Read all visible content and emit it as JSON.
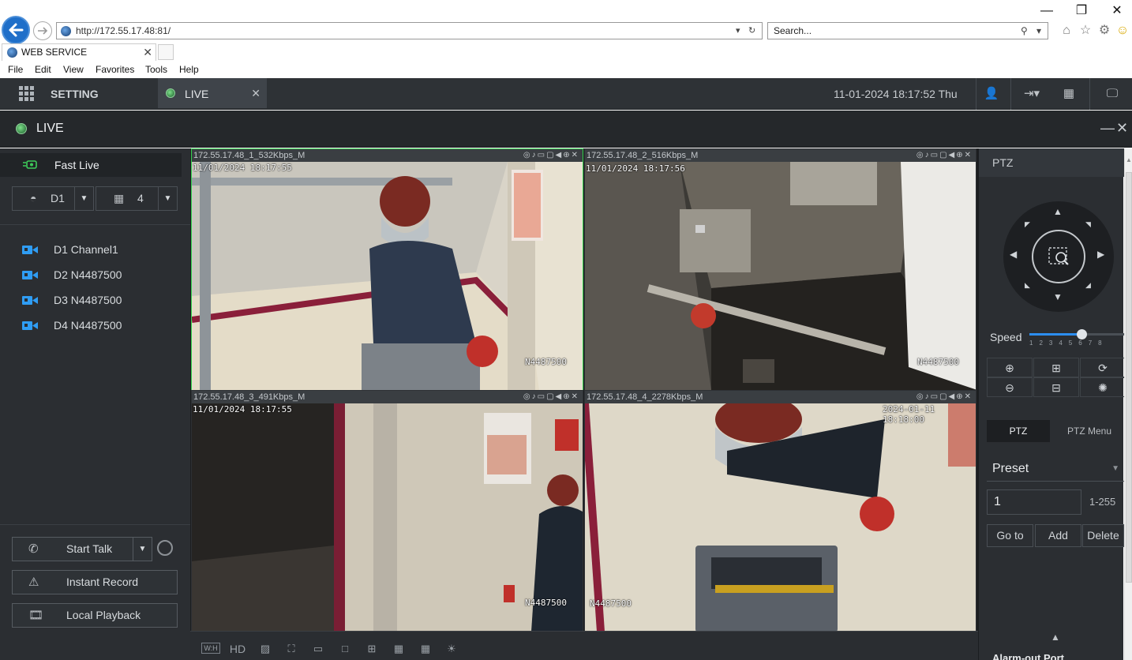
{
  "browser": {
    "address": "http://172.55.17.48:81/",
    "search_placeholder": "Search...",
    "tab_title": "WEB SERVICE",
    "menu": [
      "File",
      "Edit",
      "View",
      "Favorites",
      "Tools",
      "Help"
    ]
  },
  "app": {
    "setting_label": "SETTING",
    "live_tab_label": "LIVE",
    "datetime": "11-01-2024 18:17:52 Thu",
    "live_header": "LIVE"
  },
  "left": {
    "fast_live": "Fast Live",
    "device_select": "D1",
    "split_select": "4",
    "channels": [
      {
        "label": "D1 Channel1"
      },
      {
        "label": "D2 N4487500"
      },
      {
        "label": "D3 N4487500"
      },
      {
        "label": "D4 N4487500"
      }
    ],
    "start_talk": "Start Talk",
    "instant_record": "Instant Record",
    "local_playback": "Local Playback"
  },
  "tiles": [
    {
      "title": "172.55.17.48_1_532Kbps_M",
      "timestamp": "11/01/2024 18:17:55",
      "camera_label": "N4487500"
    },
    {
      "title": "172.55.17.48_2_516Kbps_M",
      "timestamp": "11/01/2024 18:17:56",
      "camera_label": "N4487500"
    },
    {
      "title": "172.55.17.48_3_491Kbps_M",
      "timestamp": "11/01/2024 18:17:55",
      "camera_label": "N4487500"
    },
    {
      "title": "172.55.17.48_4_2278Kbps_M",
      "timestamp": "2024-01-11 18:18:00",
      "camera_label": "N4487500"
    }
  ],
  "bottom_bar": {
    "wh": "W:H",
    "hd": "HD"
  },
  "ptz": {
    "header": "PTZ",
    "speed_label": "Speed",
    "speed_ticks": "12345678",
    "speed_value": 6,
    "tab_ptz": "PTZ",
    "tab_menu": "PTZ Menu",
    "preset_select": "Preset",
    "preset_number": "1",
    "preset_range": "1-255",
    "goto": "Go to",
    "add": "Add",
    "delete": "Delete",
    "alarm_out": "Alarm-out Port"
  }
}
